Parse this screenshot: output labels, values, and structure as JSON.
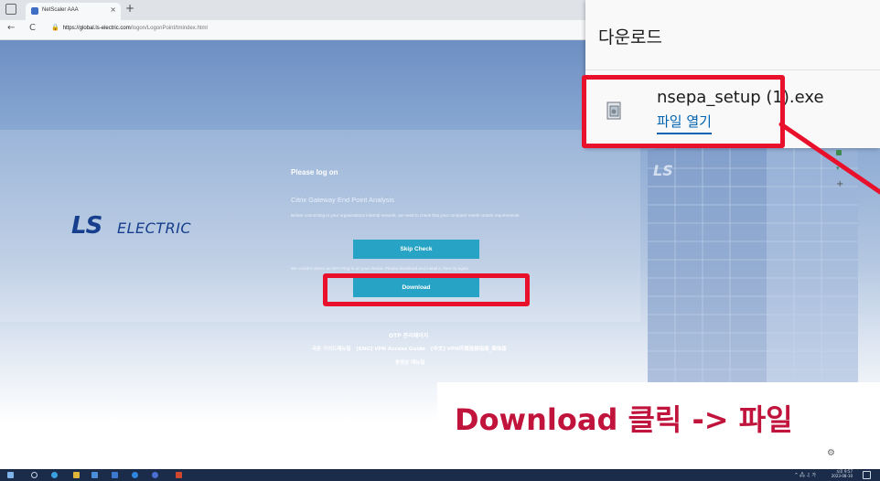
{
  "browser": {
    "tab_title": "NetScaler AAA",
    "tab_close": "×",
    "new_tab": "+",
    "back": "←",
    "reload": "C",
    "url_host": "https://global.ls-electric.com",
    "url_path": "/logon/LogonPoint/tmindex.html"
  },
  "page": {
    "logo_ls": "LS",
    "logo_electric": "ELECTRIC",
    "logon_title": "Please log on",
    "epa_title": "Citrix Gateway End Point Analysis",
    "epa_description": "Before connecting to your organizations internal network, we need to check that your computer meets certain requirements.",
    "skip_button": "Skip Check",
    "warn_text": "We couldn't detect an EPA Plug-in on your device. Please download and install it, then try again.",
    "download_button": "Download",
    "otp_link": "OTP 관리페이지",
    "guide_links": [
      "국문 가이드매뉴얼",
      "[ENG] VPN Access Guide",
      "[中文] VPN环境连接指南_简体版"
    ],
    "video_link": "동영상 매뉴얼"
  },
  "download_panel": {
    "heading": "다운로드",
    "file_name": "nsepa_setup (1).exe",
    "open_file": "파일 열기"
  },
  "caption": {
    "text": "Download 클릭 -> 파일"
  },
  "taskbar": {
    "tray": "^ 🖧 ♫ 가",
    "time": "오후 9:57",
    "date": "2023-08-10"
  },
  "colors": {
    "accent_button": "#27a3c5",
    "annotation_red": "#e8102b",
    "caption_red": "#c0143c",
    "link_blue": "#0063b1",
    "logo_blue": "#163e8c"
  }
}
